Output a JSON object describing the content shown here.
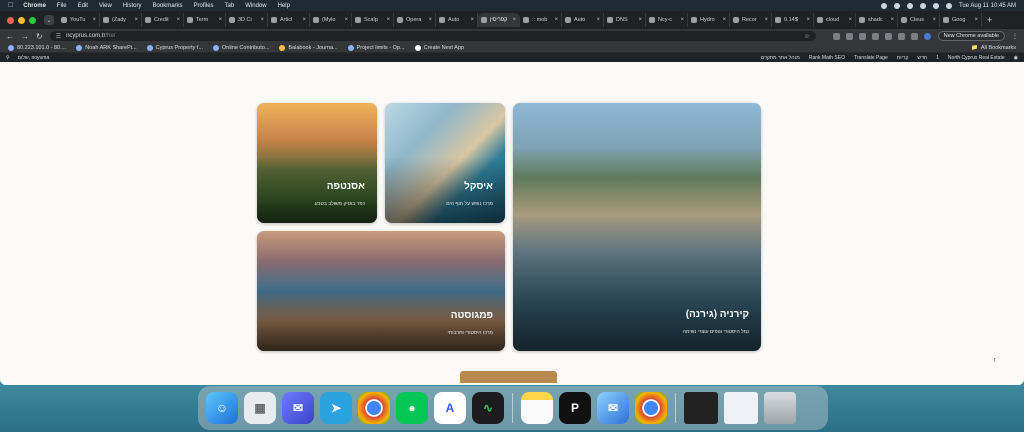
{
  "menubar": {
    "app_name": "Chrome",
    "items": [
      "File",
      "Edit",
      "View",
      "History",
      "Bookmarks",
      "Profiles",
      "Tab",
      "Window",
      "Help"
    ],
    "datetime": "Tue Aug 11  10:45 AM"
  },
  "tabs": [
    {
      "label": "YouTu"
    },
    {
      "label": "(Zady"
    },
    {
      "label": "Credit"
    },
    {
      "label": "Term"
    },
    {
      "label": "3D Ci"
    },
    {
      "label": "Articl"
    },
    {
      "label": "(Mylo"
    },
    {
      "label": "Scalp"
    },
    {
      "label": "Opera"
    },
    {
      "label": "Auto"
    },
    {
      "label": "קפריסין",
      "active": true
    },
    {
      "label": ":: mob"
    },
    {
      "label": "Auto"
    },
    {
      "label": "DNS"
    },
    {
      "label": "Ncy-c"
    },
    {
      "label": "Hydro"
    },
    {
      "label": "Recor"
    },
    {
      "label": "0.14$"
    },
    {
      "label": "cloud"
    },
    {
      "label": "shadc"
    },
    {
      "label": "Cleus"
    },
    {
      "label": "Goog"
    }
  ],
  "toolbar": {
    "url": "ncyprus.com.tr",
    "url_path": "/he/",
    "update_button": "New Chrome available"
  },
  "bookmarks": {
    "items": [
      "80.223.101.0 - 80....",
      "Noah ARK SharePi...",
      "Cyprus Property f...",
      "Online Contributo...",
      "Balabook - Journa...",
      "Project limits - Op...",
      "Create Next App"
    ],
    "all_bookmarks": "All Bookmarks"
  },
  "wp_admin_bar": {
    "left": "שלום, noyuma",
    "items": [
      "North Cyprus Real Estate",
      "1",
      "חדש",
      "קריות",
      "Translate Page",
      "Rank Math SEO",
      "מנהל אתר מתקדם"
    ]
  },
  "cards": {
    "esentepe": {
      "title": "אסנטפה",
      "subtitle": "כפר בוטיק משולב בטבע"
    },
    "iskele": {
      "title": "איסקל",
      "subtitle": "מרכז נופש על חוף הים"
    },
    "kyrenia": {
      "title": "קירניה (גירנה)",
      "subtitle": "נמל היסטורי ונופים עוצרי נשימה"
    },
    "famagusta": {
      "title": "פמגוסטה",
      "subtitle": "מרכז היסטורי ותרבותי"
    }
  },
  "dock": {
    "apps": [
      "finder-icon",
      "launchpad-icon",
      "chat-icon",
      "telegram-icon",
      "chrome-icon",
      "line-icon",
      "arc-icon",
      "activity-monitor-icon",
      "notes-icon",
      "parallels-icon",
      "mail-icon",
      "chrome-alt-icon",
      "window-thumb-icon",
      "preview-icon",
      "trash-icon"
    ]
  }
}
